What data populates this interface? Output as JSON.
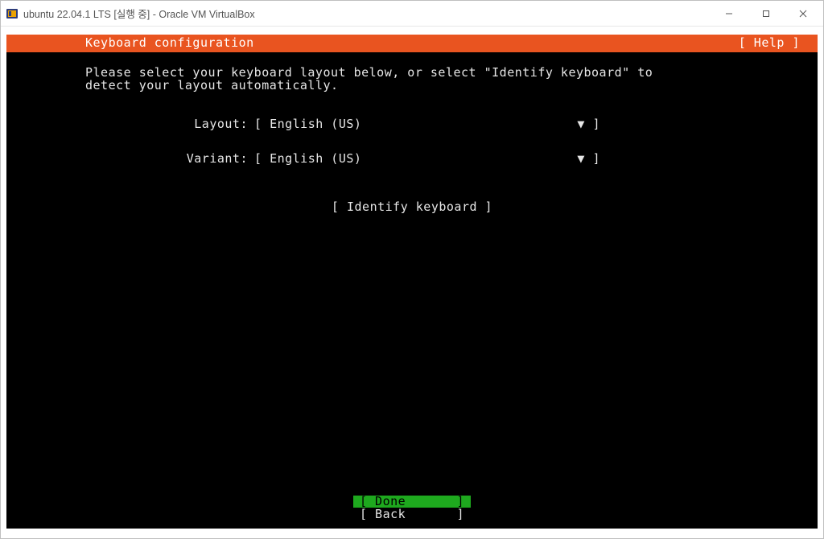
{
  "window": {
    "title": "ubuntu 22.04.1 LTS [실행 중] - Oracle VM VirtualBox"
  },
  "installer": {
    "header_title": "Keyboard configuration",
    "help_label": "[ Help ]",
    "instruction": "Please select your keyboard layout below, or select \"Identify keyboard\" to\ndetect your layout automatically.",
    "fields": {
      "layout_label": "Layout:",
      "layout_value": "English (US)",
      "variant_label": "Variant:",
      "variant_value": "English (US)"
    },
    "identify_label": "[ Identify keyboard ]",
    "buttons": {
      "done": "[ Done",
      "done_tail": "]",
      "back": "[ Back",
      "back_tail": "]"
    },
    "colors": {
      "orange": "#e95420",
      "green_selected": "#1ea91e"
    }
  },
  "glyphs": {
    "bracket_open": "[ ",
    "bracket_close": " ]",
    "down_triangle": "▼"
  }
}
